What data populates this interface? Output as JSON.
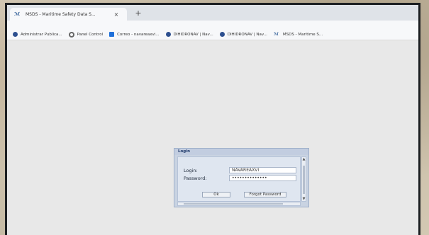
{
  "browser": {
    "tab": {
      "title": "MSDS - Maritime Safety Data S...",
      "close": "×"
    },
    "new_tab": "+",
    "bookmarks": [
      {
        "label": "Administrar Publica...",
        "icon": "globe-icon"
      },
      {
        "label": "Panel Control",
        "icon": "gear-icon"
      },
      {
        "label": "Correo - navareaxvi...",
        "icon": "mail-icon"
      },
      {
        "label": "DIHIDRONAV | Nav...",
        "icon": "globe-icon"
      },
      {
        "label": "DIHIDRONAV | Nav...",
        "icon": "globe-icon"
      },
      {
        "label": "MSDS - Maritime S...",
        "icon": "msds-logo-icon"
      }
    ]
  },
  "login_dialog": {
    "title": "Login",
    "login_label": "Login:",
    "login_value": "NAVAREAXVI",
    "password_label": "Password:",
    "password_value": "••••••••••••••",
    "ok_label": "Ok",
    "forgot_label": "Forgot Password"
  },
  "colors": {
    "dialog_bg": "#c9d3e2",
    "page_bg": "#e8e8e8",
    "monitor_bezel": "#1c1f22"
  }
}
